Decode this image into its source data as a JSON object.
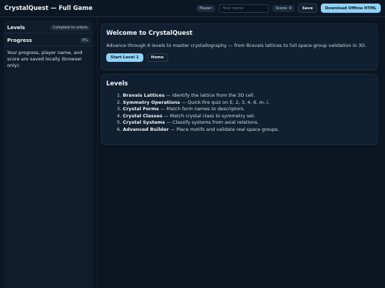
{
  "header": {
    "title": "CrystalQuest — Full Game",
    "player_label": "Player:",
    "player_placeholder": "Your name",
    "score_label": "Score: 0",
    "save_label": "Save",
    "download_label": "Download Offline HTML"
  },
  "sidebar": {
    "levels_title": "Levels",
    "levels_badge": "Complete to unlock",
    "progress_title": "Progress",
    "progress_badge": "0%",
    "note": "Your progress, player name, and score are saved locally (browser only)."
  },
  "welcome": {
    "title": "Welcome to CrystalQuest",
    "text": "Advance through 6 levels to master crystallography — from Bravais lattices to full space-group validation in 3D.",
    "start_label": "Start Level 1",
    "home_label": "Home"
  },
  "levels": {
    "title": "Levels",
    "items": [
      {
        "num": "1.",
        "name": "Bravais Lattices",
        "desc": " — Identify the lattice from the 3D cell."
      },
      {
        "num": "2.",
        "name": "Symmetry Operations",
        "desc": " — Quick-fire quiz on E, 2, 3, 4, 6, m, i."
      },
      {
        "num": "3.",
        "name": "Crystal Forms",
        "desc": " — Match form names to descriptors."
      },
      {
        "num": "4.",
        "name": "Crystal Classes",
        "desc": " — Match crystal class to symmetry set."
      },
      {
        "num": "5.",
        "name": "Crystal Systems",
        "desc": " — Classify systems from axial relations."
      },
      {
        "num": "6.",
        "name": "Advanced Builder",
        "desc": " — Place motifs and validate real space groups."
      }
    ]
  },
  "colors": {
    "background": "#0b1521",
    "panel": "#112030",
    "accent": "#8fd3f5",
    "text": "#dde6ef"
  }
}
